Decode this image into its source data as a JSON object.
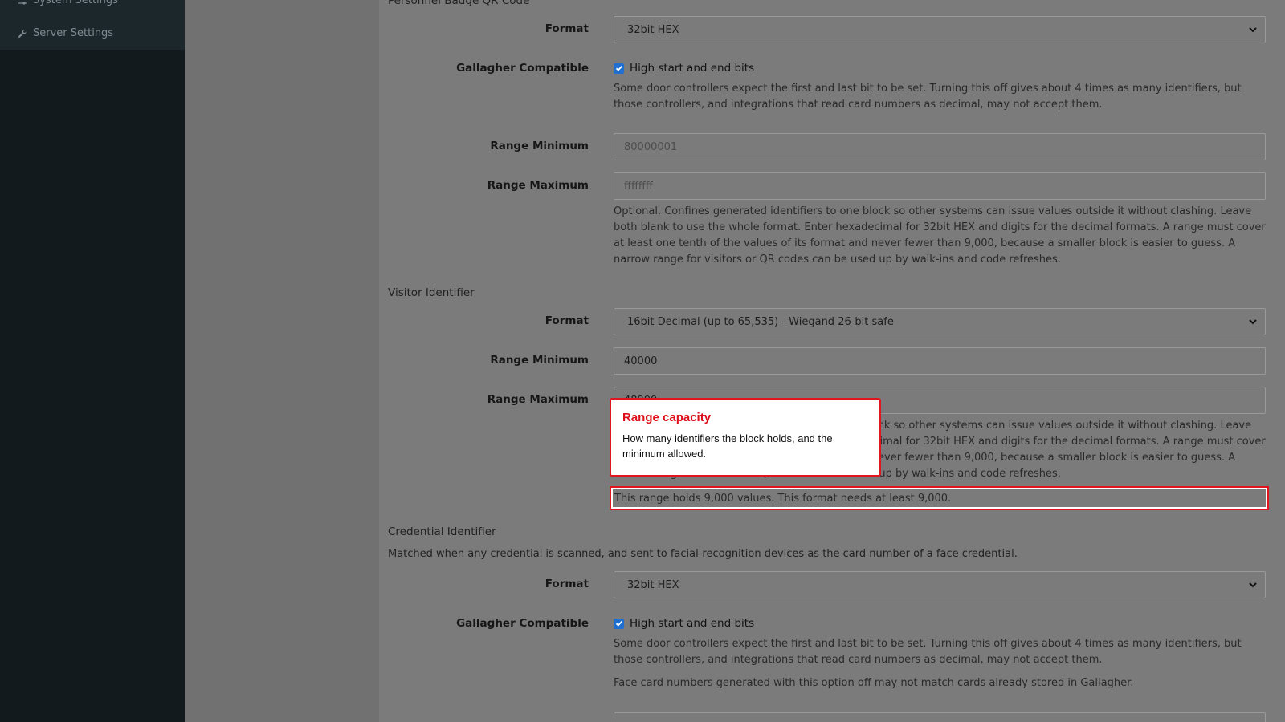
{
  "sidebar": {
    "items": [
      {
        "label": "System Settings",
        "icon": "sliders-icon"
      },
      {
        "label": "Server Settings",
        "icon": "wrench-icon"
      }
    ]
  },
  "personnel_qr": {
    "title": "Personnel Badge QR Code",
    "format_label": "Format",
    "format_value": "32bit HEX",
    "gallagher_label": "Gallagher Compatible",
    "gallagher_checkbox_label": "High start and end bits",
    "gallagher_checked": true,
    "gallagher_help": "Some door controllers expect the first and last bit to be set. Turning this off gives about 4 times as many identifiers, but those controllers, and integrations that read card numbers as decimal, may not accept them.",
    "range_min_label": "Range Minimum",
    "range_min_placeholder": "80000001",
    "range_max_label": "Range Maximum",
    "range_max_placeholder": "ffffffff",
    "range_help": "Optional. Confines generated identifiers to one block so other systems can issue values outside it without clashing. Leave both blank to use the whole format. Enter hexadecimal for 32bit HEX and digits for the decimal formats. A range must cover at least one tenth of the values of its format and never fewer than 9,000, because a smaller block is easier to guess. A narrow range for visitors or QR codes can be used up by walk-ins and code refreshes."
  },
  "visitor": {
    "title": "Visitor Identifier",
    "format_label": "Format",
    "format_value": "16bit Decimal (up to 65,535) - Wiegand 26-bit safe",
    "range_min_label": "Range Minimum",
    "range_min_value": "40000",
    "range_max_label": "Range Maximum",
    "range_max_value": "48999",
    "range_help": "Optional. Confines generated identifiers to one block so other systems can issue values outside it without clashing. Leave both blank to use the whole format. Enter hexadecimal for 32bit HEX and digits for the decimal formats. A range must cover at least one tenth of the values of its format and never fewer than 9,000, because a smaller block is easier to guess. A narrow range for visitors or QR codes can be used up by walk-ins and code refreshes.",
    "capacity_text": "This range holds 9,000 values. This format needs at least 9,000."
  },
  "callout": {
    "title": "Range capacity",
    "body": "How many identifiers the block holds, and the minimum allowed."
  },
  "credential": {
    "title": "Credential Identifier",
    "description": "Matched when any credential is scanned, and sent to facial-recognition devices as the card number of a face credential.",
    "format_label": "Format",
    "format_value": "32bit HEX",
    "gallagher_label": "Gallagher Compatible",
    "gallagher_checkbox_label": "High start and end bits",
    "gallagher_checked": true,
    "gallagher_help": "Some door controllers expect the first and last bit to be set. Turning this off gives about 4 times as many identifiers, but those controllers, and integrations that read card numbers as decimal, may not accept them.",
    "gallagher_note": "Face card numbers generated with this option off may not match cards already stored in Gallagher."
  },
  "colors": {
    "accent_red": "#e0151f",
    "checkbox_blue": "#1f6fd1",
    "sidebar_bg": "#121a1d"
  }
}
